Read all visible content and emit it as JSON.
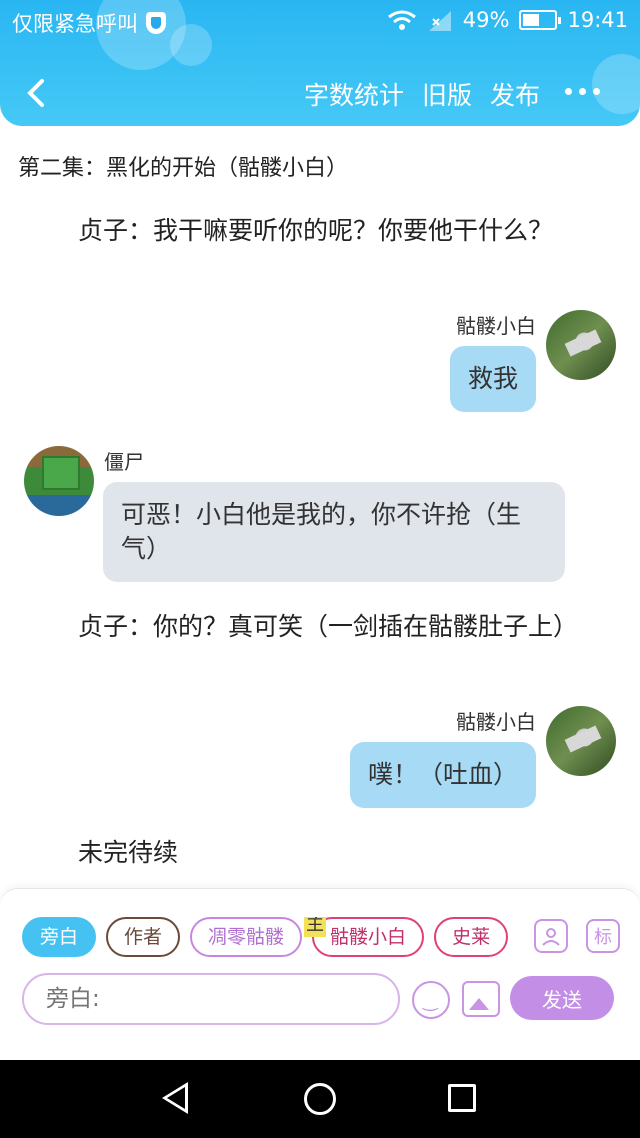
{
  "status_bar": {
    "carrier_text": "仅限紧急呼叫",
    "battery": "49%",
    "time": "19:41"
  },
  "nav": {
    "actions": [
      "字数统计",
      "旧版",
      "发布"
    ]
  },
  "chapter_title": "第二集：黑化的开始（骷髅小白）",
  "messages": [
    {
      "type": "narration",
      "text": "贞子：我干嘛要听你的呢？你要他干什么？"
    },
    {
      "type": "bubble",
      "side": "right",
      "speaker": "骷髅小白",
      "text": "救我",
      "avatar": "skeleton-avatar"
    },
    {
      "type": "bubble",
      "side": "left",
      "speaker": "僵尸",
      "text": "可恶！小白他是我的，你不许抢（生气）",
      "avatar": "zombie-avatar"
    },
    {
      "type": "narration",
      "text": "贞子：你的？真可笑（一剑插在骷髅肚子上）"
    },
    {
      "type": "bubble",
      "side": "right",
      "speaker": "骷髅小白",
      "text": "噗！（吐血）",
      "avatar": "skeleton-avatar"
    },
    {
      "type": "narration",
      "text": "未完待续"
    }
  ],
  "roles": {
    "narrator": "旁白",
    "author": "作者",
    "withered_skeleton": "凋零骷髅",
    "main_tag": "主",
    "skeleton_xiaobai": "骷髅小白",
    "slime": "史莱"
  },
  "tools": {
    "tag_label": "标"
  },
  "input": {
    "placeholder": "旁白:"
  },
  "send_label": "发送",
  "colors": {
    "header": "#29b6f2",
    "accent": "#c38ee6",
    "right_bubble": "#a7dbf5",
    "left_bubble": "#e0e4eb"
  }
}
